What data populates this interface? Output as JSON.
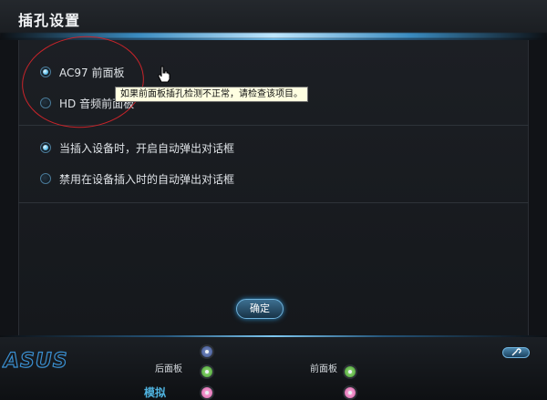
{
  "window": {
    "title": "插孔设置"
  },
  "front_panel": {
    "options": [
      {
        "label": "AC97 前面板",
        "checked": true
      },
      {
        "label": "HD 音频前面板",
        "checked": false
      }
    ],
    "tooltip": "如果前面板插孔检测不正常，请检查该项目。"
  },
  "dialog_options": [
    {
      "label": "当插入设备时，开启自动弹出对话框",
      "checked": true
    },
    {
      "label": "禁用在设备插入时的自动弹出对话框",
      "checked": false
    }
  ],
  "buttons": {
    "ok": "确定"
  },
  "footer": {
    "logo": "ASUS",
    "back_panel_label": "后面板",
    "front_panel_label": "前面板",
    "mode_label": "模拟"
  },
  "colors": {
    "accent": "#4fb3e0",
    "annotation": "#c8242a",
    "jack_blue": "#5b6fae",
    "jack_green": "#5cc13f",
    "jack_pink": "#f07cc4"
  },
  "icons": {
    "cursor": "hand-pointer-icon",
    "tool": "wrench-icon"
  }
}
